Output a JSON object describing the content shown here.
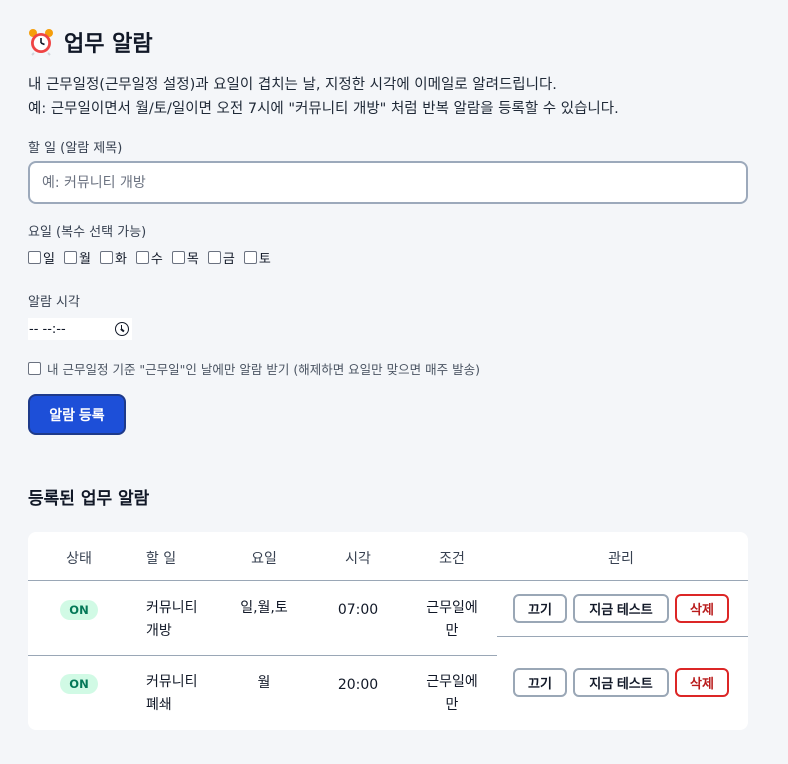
{
  "header": {
    "title": "업무 알람",
    "icon": "alarm-clock-icon"
  },
  "description": {
    "line1": "내 근무일정(근무일정 설정)과 요일이 겹치는 날, 지정한 시각에 이메일로 알려드립니다.",
    "line2": "예: 근무일이면서 월/토/일이면 오전 7시에 \"커뮤니티 개방\" 처럼 반복 알람을 등록할 수 있습니다."
  },
  "form": {
    "task_label": "할 일 (알람 제목)",
    "task_placeholder": "예: 커뮤니티 개방",
    "task_value": "",
    "days_label": "요일 (복수 선택 가능)",
    "days": [
      {
        "label": "일",
        "checked": false
      },
      {
        "label": "월",
        "checked": false
      },
      {
        "label": "화",
        "checked": false
      },
      {
        "label": "수",
        "checked": false
      },
      {
        "label": "목",
        "checked": false
      },
      {
        "label": "금",
        "checked": false
      },
      {
        "label": "토",
        "checked": false
      }
    ],
    "time_label": "알람 시각",
    "time_value": "-- --:--",
    "workday_only_label": "내 근무일정 기준 \"근무일\"인 날에만 알람 받기 (해제하면 요일만 맞으면 매주 발송)",
    "workday_only_checked": false,
    "submit_label": "알람 등록"
  },
  "list": {
    "title": "등록된 업무 알람",
    "columns": [
      "상태",
      "할 일",
      "요일",
      "시각",
      "조건",
      "관리"
    ],
    "rows": [
      {
        "status": "ON",
        "task_line1": "커뮤니티",
        "task_line2": "개방",
        "days": "일,월,토",
        "time": "07:00",
        "cond_line1": "근무일에",
        "cond_line2": "만",
        "off_label": "끄기",
        "test_label": "지금 테스트",
        "delete_label": "삭제"
      },
      {
        "status": "ON",
        "task_line1": "커뮤니티",
        "task_line2": "폐쇄",
        "days": "월",
        "time": "20:00",
        "cond_line1": "근무일에",
        "cond_line2": "만",
        "off_label": "끄기",
        "test_label": "지금 테스트",
        "delete_label": "삭제"
      }
    ]
  },
  "colors": {
    "accent": "#1d4fd8",
    "on_badge_bg": "#d1fae5",
    "on_badge_text": "#047857",
    "danger": "#dc2626",
    "background": "#f4f6f9"
  }
}
